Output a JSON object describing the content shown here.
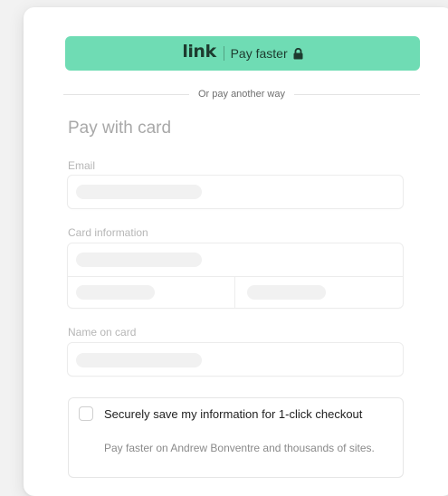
{
  "colors": {
    "link_green": "#6fdcb4",
    "link_text": "#1d3b2f"
  },
  "link_button": {
    "logo": "link",
    "label": "Pay faster",
    "icon": "lock-icon"
  },
  "divider": {
    "text": "Or pay another way"
  },
  "form": {
    "title": "Pay with card",
    "email_label": "Email",
    "card_label": "Card information",
    "name_label": "Name on card"
  },
  "save_option": {
    "title": "Securely save my information for 1-click checkout",
    "subtitle": "Pay faster on Andrew Bonventre and thousands of sites.",
    "checked": false
  }
}
